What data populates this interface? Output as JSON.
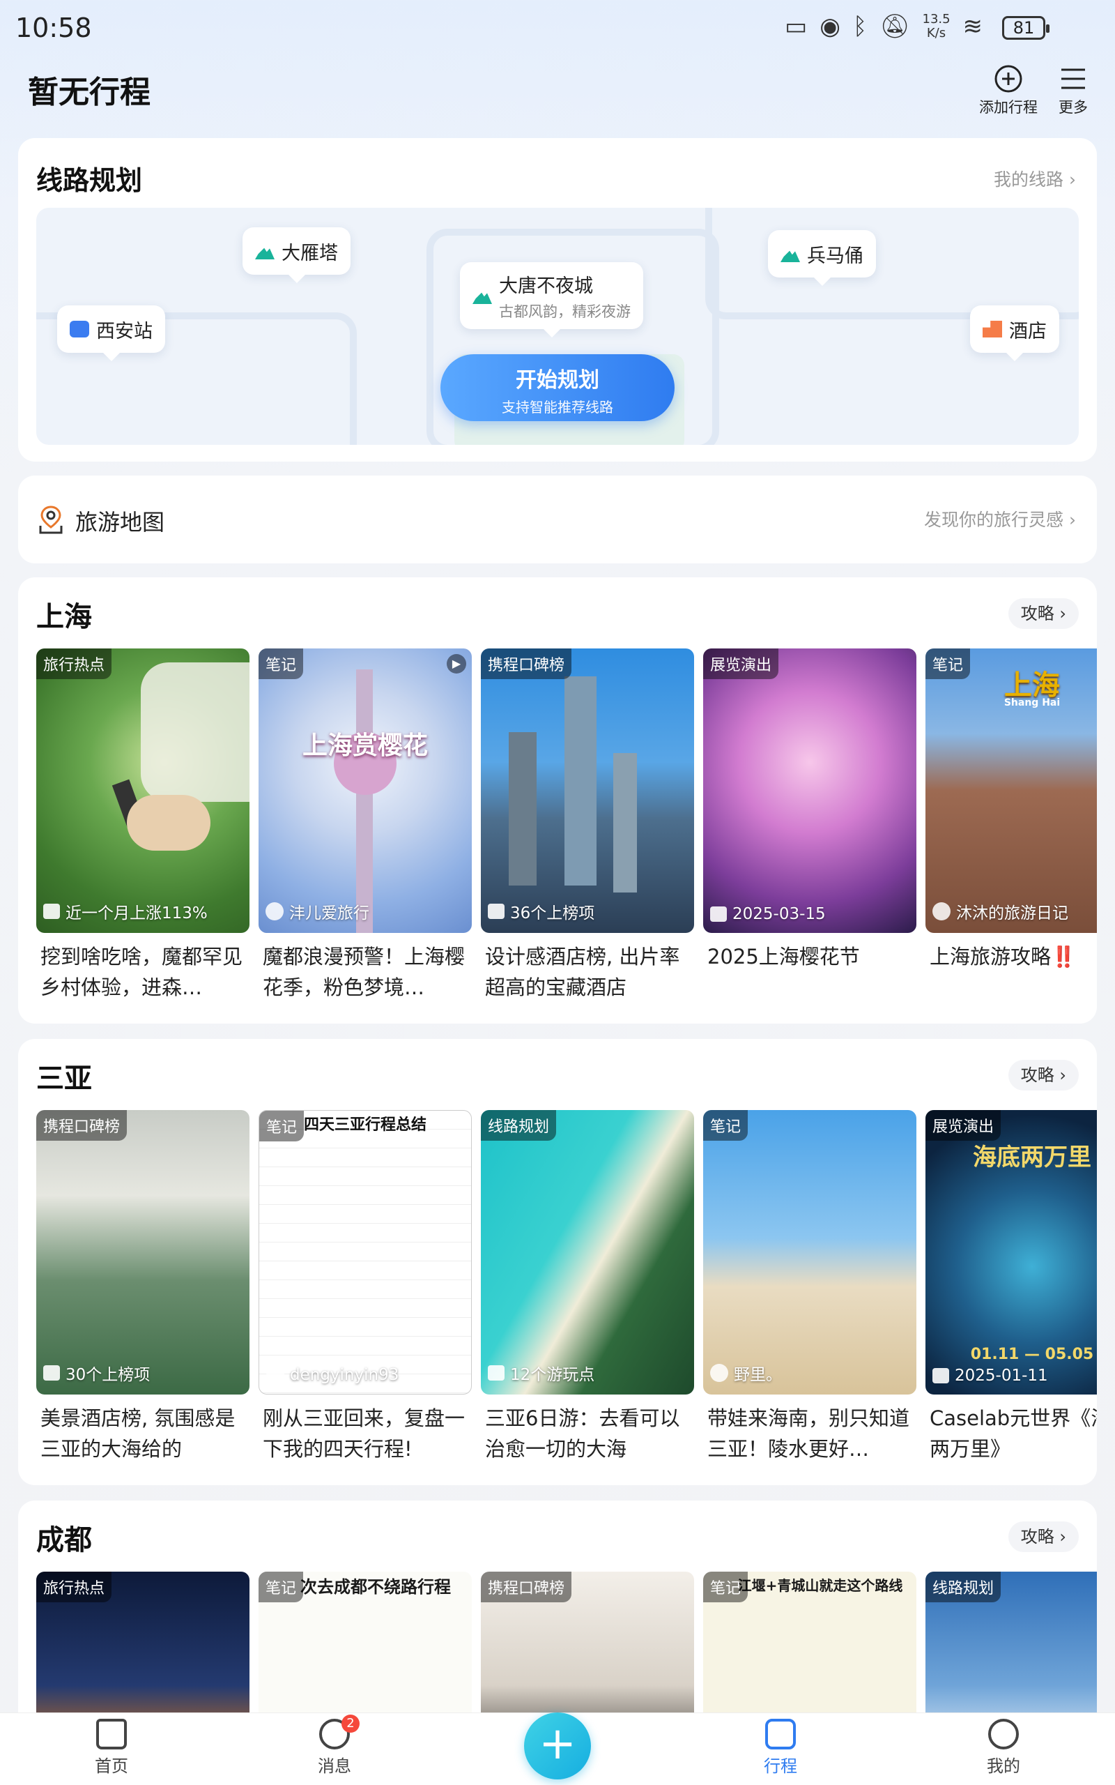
{
  "status_bar": {
    "time": "10:58",
    "net_speed_value": "13.5",
    "net_speed_unit": "K/s",
    "battery": "81",
    "icons": [
      "cast-icon",
      "eye-icon",
      "bluetooth-icon",
      "mute-icon",
      "wifi-icon",
      "battery-icon"
    ]
  },
  "header": {
    "title": "暂无行程",
    "add_label": "添加行程",
    "more_label": "更多"
  },
  "route_planning": {
    "title": "线路规划",
    "my_routes": "我的线路 ›",
    "pois": {
      "xian_station": "西安站",
      "big_goose": "大雁塔",
      "datang_title": "大唐不夜城",
      "datang_sub": "古都风韵，精彩夜游",
      "terracotta": "兵马俑",
      "hotel": "酒店"
    },
    "start_button": "开始规划",
    "start_sub": "支持智能推荐线路"
  },
  "travel_map": {
    "label": "旅游地图",
    "hint": "发现你的旅行灵感 ›"
  },
  "cities": [
    {
      "name": "上海",
      "guide": "攻略 ›",
      "tiles": [
        {
          "tag": "旅行热点",
          "meta": "近一个月上涨113%",
          "title": "挖到啥吃啥，魔都罕见乡村体验，进森…"
        },
        {
          "tag": "笔记",
          "meta": "沣儿爱旅行",
          "overlay": "上海赏樱花",
          "title": "魔都浪漫预警！上海樱花季，粉色梦境…"
        },
        {
          "tag": "携程口碑榜",
          "meta": "36个上榜项",
          "title": "设计感酒店榜, 出片率超高的宝藏酒店"
        },
        {
          "tag": "展览演出",
          "meta": "2025-03-15",
          "title": "2025上海樱花节"
        },
        {
          "tag": "笔记",
          "meta": "沐沐的旅游日记",
          "overlay": "上海",
          "overlay_sub": "Shang Hai",
          "title": "上海旅游攻略‼️"
        }
      ]
    },
    {
      "name": "三亚",
      "guide": "攻略 ›",
      "tiles": [
        {
          "tag": "携程口碑榜",
          "meta": "30个上榜项",
          "title": "美景酒店榜, 氛围感是三亚的大海给的"
        },
        {
          "tag": "笔记",
          "meta": "dengyinyin93",
          "overlay": "四天三亚行程总结",
          "title": "刚从三亚回来，复盘一下我的四天行程!"
        },
        {
          "tag": "线路规划",
          "meta": "12个游玩点",
          "title": "三亚6日游：去看可以治愈一切的大海"
        },
        {
          "tag": "笔记",
          "meta": "野里。",
          "title": "带娃来海南，别只知道三亚！陵水更好…"
        },
        {
          "tag": "展览演出",
          "meta": "2025-01-11",
          "overlay": "海底两万里",
          "overlay_dates": "01.11 — 05.05",
          "title": "Caselab元世界《海底两万里》"
        }
      ]
    },
    {
      "name": "成都",
      "guide": "攻略 ›",
      "tiles": [
        {
          "tag": "旅行热点"
        },
        {
          "tag": "笔记",
          "overlay": "次去成都不绕路行程"
        },
        {
          "tag": "携程口碑榜"
        },
        {
          "tag": "笔记",
          "overlay": "江堰+青城山就走这个路线"
        },
        {
          "tag": "线路规划"
        }
      ]
    }
  ],
  "bottom_nav": {
    "home": "首页",
    "messages": "消息",
    "messages_badge": "2",
    "plus": "+",
    "trips": "行程",
    "mine": "我的"
  },
  "colors": {
    "accent": "#2f7cf0",
    "plus_button": "#16aee0",
    "badge": "#f5483b"
  }
}
